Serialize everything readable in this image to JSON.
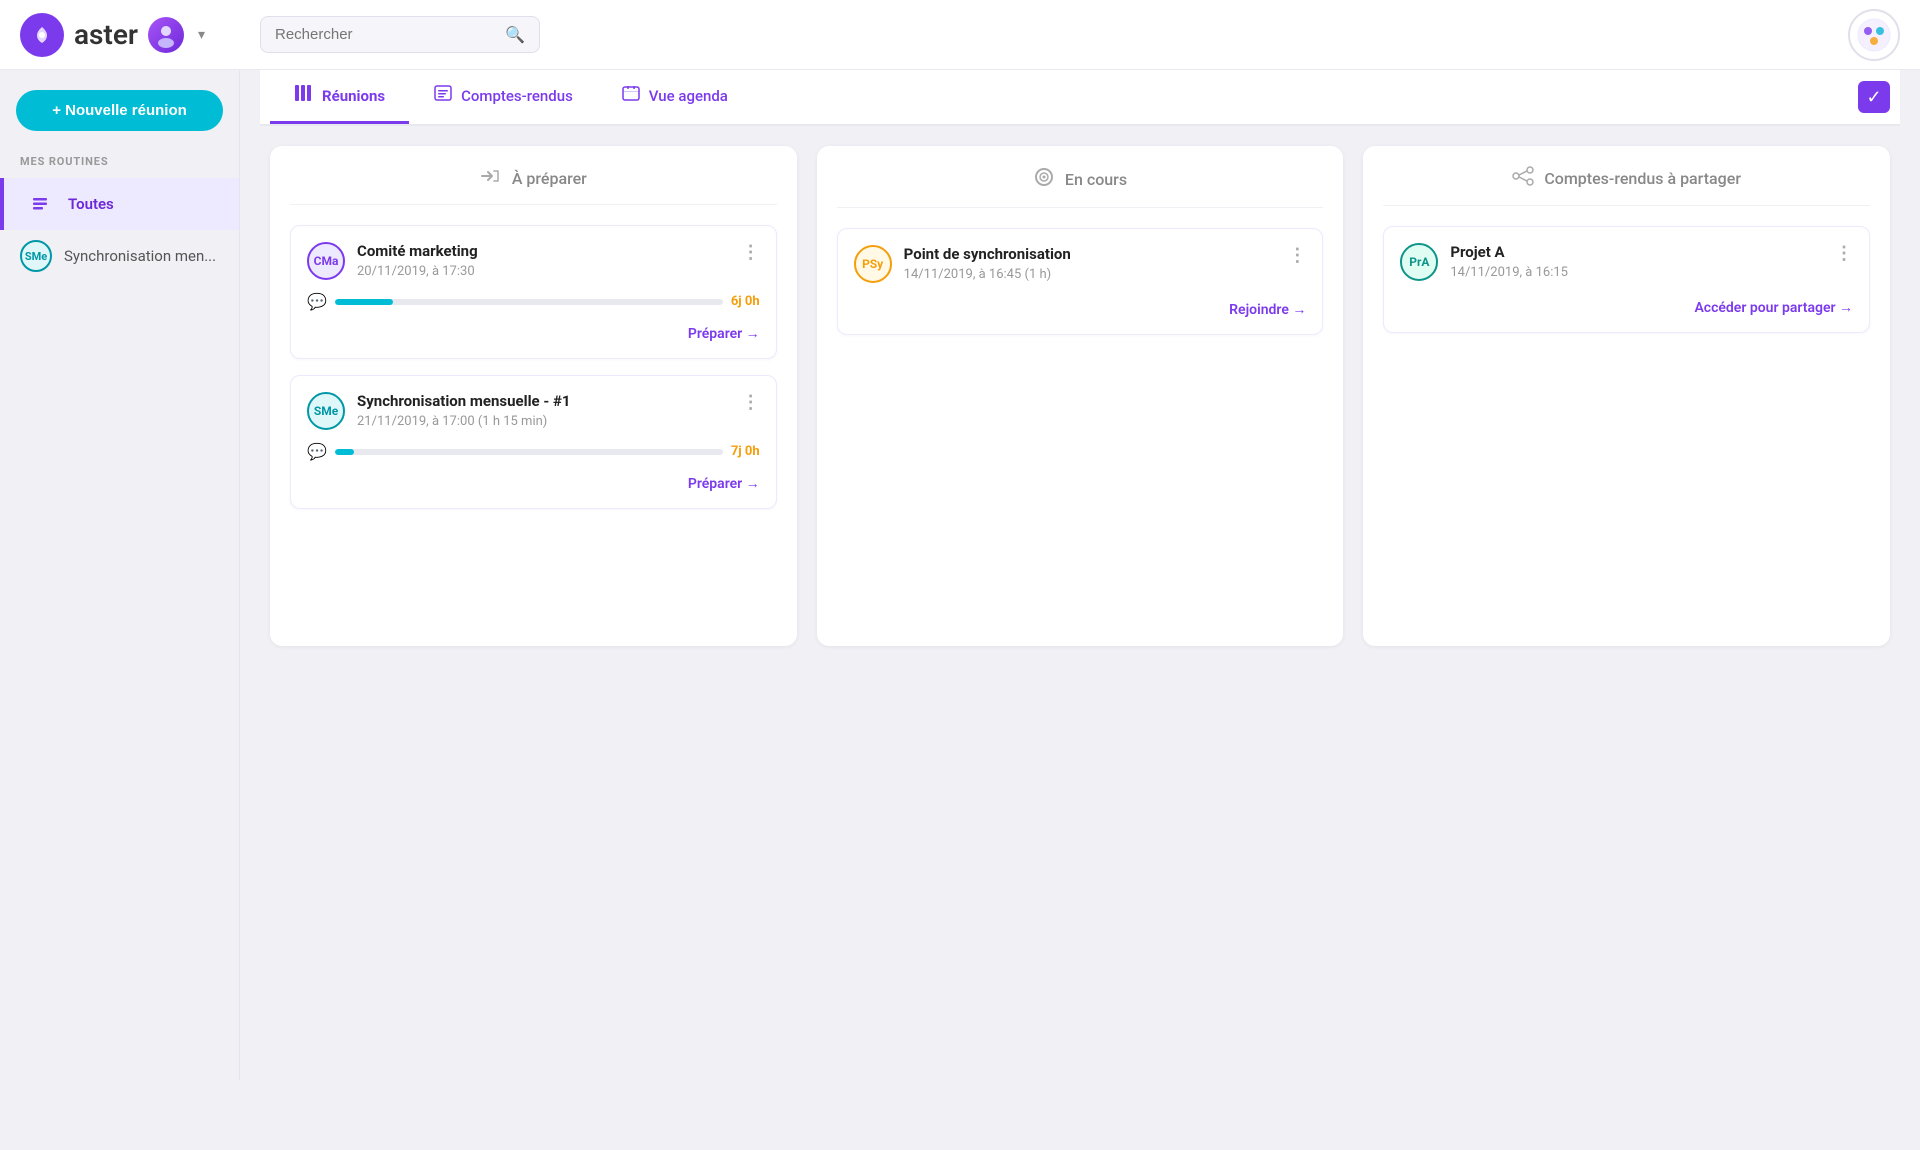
{
  "app": {
    "name": "aster",
    "logo_symbol": "✳"
  },
  "header": {
    "search_placeholder": "Rechercher",
    "search_icon": "🔍"
  },
  "sidebar": {
    "new_meeting_label": "+ Nouvelle réunion",
    "section_label": "MES ROUTINES",
    "items": [
      {
        "id": "toutes",
        "label": "Toutes",
        "icon": "📋",
        "active": true
      },
      {
        "id": "sync",
        "label": "Synchronisation men...",
        "initials": "SMe",
        "active": false
      }
    ]
  },
  "tabs": [
    {
      "id": "reunions",
      "label": "Réunions",
      "icon": "▦",
      "active": true
    },
    {
      "id": "comptes-rendus",
      "label": "Comptes-rendus",
      "icon": "▤",
      "active": false
    },
    {
      "id": "vue-agenda",
      "label": "Vue agenda",
      "icon": "▦",
      "active": false
    }
  ],
  "columns": [
    {
      "id": "a-preparer",
      "header_icon": "➤",
      "header_label": "À préparer",
      "cards": [
        {
          "id": "comite-marketing",
          "avatar_initials": "CMa",
          "avatar_class": "avatar-cma",
          "title": "Comité marketing",
          "date": "20/11/2019, à 17:30",
          "progress_percent": 15,
          "progress_label": "6j 0h",
          "action_label": "Préparer →"
        },
        {
          "id": "synchronisation-mensuelle",
          "avatar_initials": "SMe",
          "avatar_class": "avatar-sme",
          "title": "Synchronisation mensuelle - #1",
          "date": "21/11/2019, à 17:00 (1 h 15 min)",
          "progress_percent": 5,
          "progress_label": "7j 0h",
          "action_label": "Préparer →"
        }
      ]
    },
    {
      "id": "en-cours",
      "header_icon": "◎",
      "header_label": "En cours",
      "cards": [
        {
          "id": "point-synchronisation",
          "avatar_initials": "PSy",
          "avatar_class": "avatar-psy",
          "title": "Point de synchronisation",
          "date": "14/11/2019, à 16:45 (1 h)",
          "progress_percent": 0,
          "progress_label": "",
          "action_label": "Rejoindre →"
        }
      ]
    },
    {
      "id": "comptes-rendus-partager",
      "header_icon": "⇄",
      "header_label": "Comptes-rendus à partager",
      "cards": [
        {
          "id": "projet-a",
          "avatar_initials": "PrA",
          "avatar_class": "avatar-pra",
          "title": "Projet A",
          "date": "14/11/2019, à 16:15",
          "progress_percent": 0,
          "progress_label": "",
          "action_label": "Accéder pour partager →"
        }
      ]
    }
  ]
}
